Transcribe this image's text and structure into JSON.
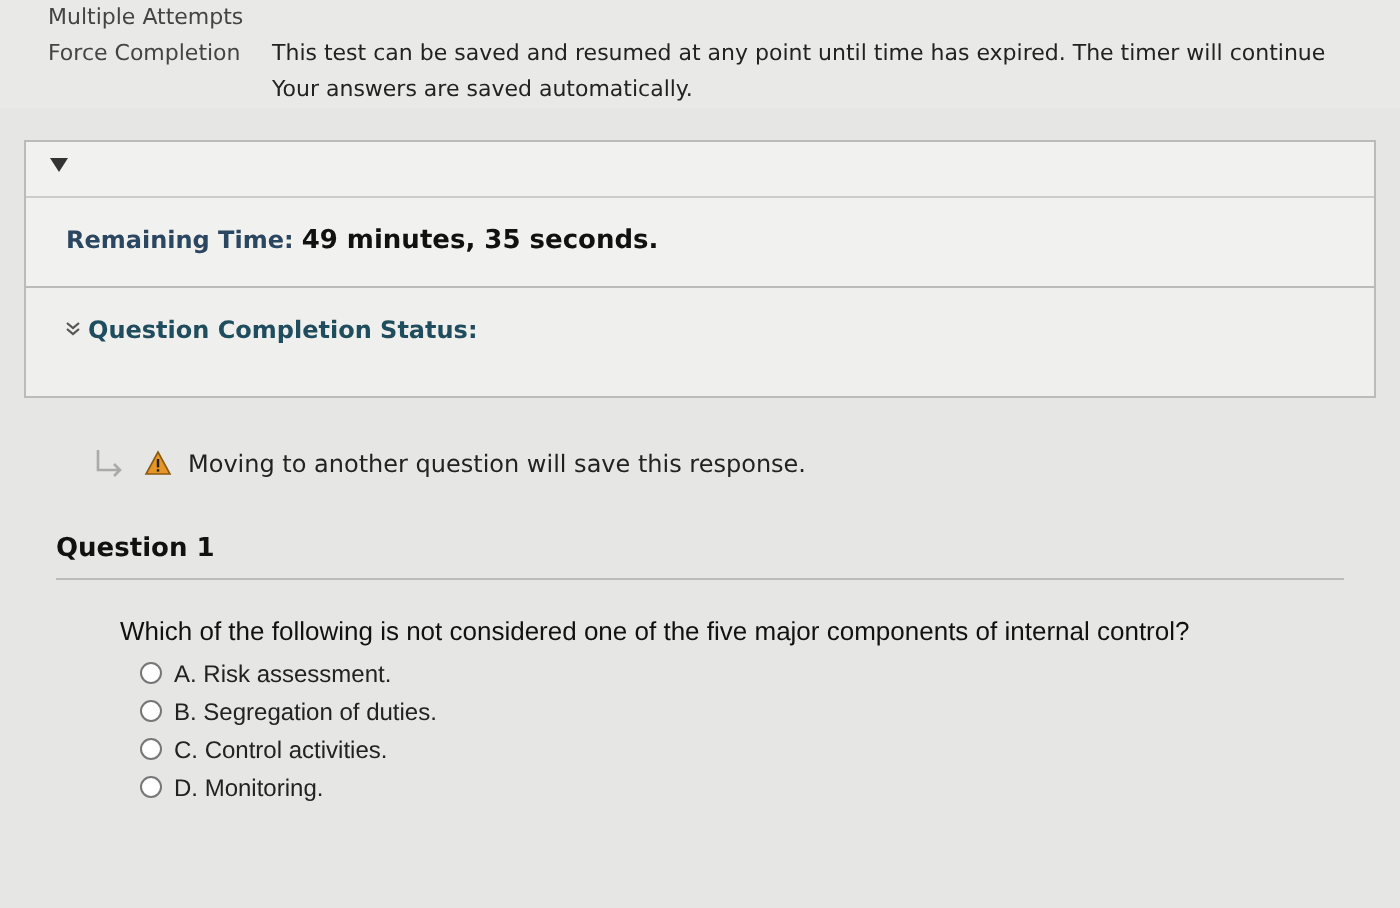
{
  "test_info": {
    "rows": [
      {
        "label": "Multiple Attempts",
        "value": ""
      },
      {
        "label": "Force Completion",
        "value": "This test can be saved and resumed at any point until time has expired. The timer will continue",
        "value_2": "Your answers are saved automatically."
      }
    ]
  },
  "timer": {
    "expanded": true,
    "label": "Remaining Time:",
    "value": "49 minutes, 35 seconds."
  },
  "completion_status": {
    "expanded": false,
    "label": "Question Completion Status:"
  },
  "notice": "Moving to another question will save this response.",
  "question": {
    "title": "Question 1",
    "text": "Which of the following is not considered one of the five major components of internal control?",
    "options": [
      {
        "label": "A. Risk assessment.",
        "selected": false
      },
      {
        "label": "B. Segregation of duties.",
        "selected": false
      },
      {
        "label": "C. Control activities.",
        "selected": false
      },
      {
        "label": "D. Monitoring.",
        "selected": false
      }
    ]
  }
}
